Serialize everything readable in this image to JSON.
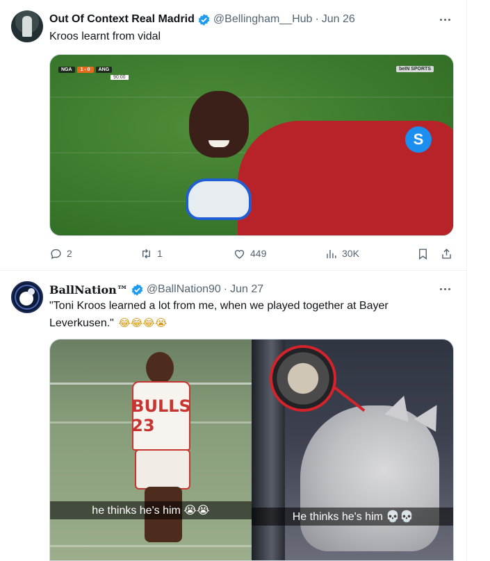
{
  "tweets": [
    {
      "author": {
        "name": "Out Of Context Real Madrid",
        "handle": "@Bellingham__Hub",
        "verified": true,
        "avatar_icon": "player-photo-avatar"
      },
      "date": "Jun 26",
      "separator": "·",
      "text": "Kroos learnt from vidal",
      "media": {
        "kind": "image",
        "description_icons": [
          "scoreboard-overlay",
          "shazam-icon",
          "broadcaster-logo"
        ],
        "overlay": {
          "team_home": "NGA",
          "score": "1 - 0",
          "team_away": "ANG",
          "clock": "90:00",
          "broadcaster": "beIN SPORTS"
        }
      },
      "stats": {
        "replies": "2",
        "retweets": "1",
        "likes": "449",
        "views": "30K"
      }
    },
    {
      "author": {
        "name": "BallNation™",
        "handle": "@BallNation90",
        "verified": true,
        "avatar_icon": "ballnation-logo-avatar"
      },
      "date": "Jun 27",
      "separator": "·",
      "text": "\"Toni Kroos learned a lot from me, when we played together at Bayer Leverkusen.\"",
      "emoji": "😂😂😂😭",
      "media": {
        "kind": "image",
        "left_caption": "he thinks he's him 😭😭",
        "right_caption": "He thinks he's him 💀💀",
        "jersey_text": "BULLS 23"
      }
    }
  ],
  "colors": {
    "verified": "#1d9bf0",
    "secondary_text": "#536471",
    "primary_text": "#0f1419",
    "border": "#eff3f4",
    "shazam": "#1c8ef0",
    "bulls_red": "#c83430"
  }
}
